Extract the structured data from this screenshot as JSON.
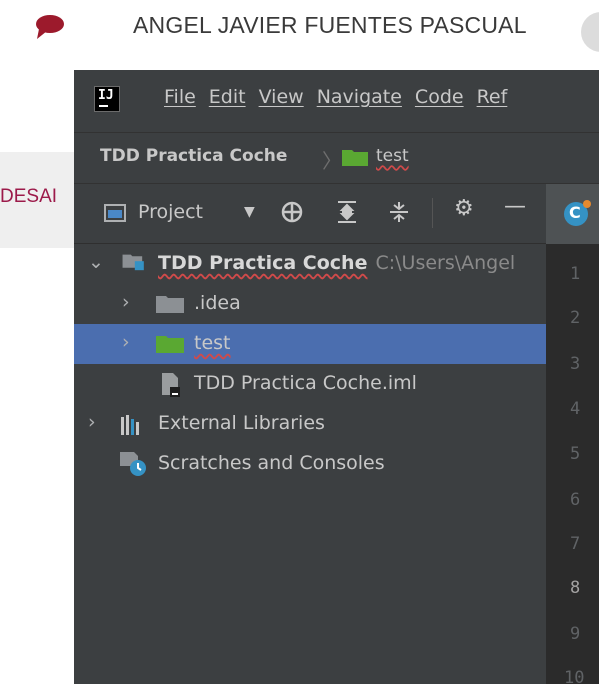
{
  "background_page": {
    "user_name": "ANGEL JAVIER FUENTES PASCUAL",
    "tab_fragment": "DESAI",
    "chat_icon_color": "#9c1a2c"
  },
  "ide": {
    "logo_text": "IJ",
    "menu": [
      "File",
      "Edit",
      "View",
      "Navigate",
      "Code",
      "Ref"
    ],
    "breadcrumb": {
      "project": "TDD Practica Coche",
      "folder": "test"
    },
    "toolbar": {
      "view_label": "Project"
    },
    "tree": {
      "root": {
        "label": "TDD Practica Coche",
        "path": "C:\\Users\\Angel"
      },
      "idea_folder": ".idea",
      "test_folder": "test",
      "iml_file": "TDD Practica Coche.iml",
      "external_libraries": "External Libraries",
      "scratches": "Scratches and Consoles"
    },
    "editor": {
      "tab_icon_letter": "C",
      "line_numbers": [
        "1",
        "2",
        "3",
        "4",
        "5",
        "6",
        "7",
        "8",
        "9",
        "10"
      ],
      "active_line": "8"
    },
    "colors": {
      "selection": "#4b6eaf",
      "folder_green": "#5aa832",
      "panel": "#3c3f41",
      "editor": "#2b2b2b"
    }
  }
}
